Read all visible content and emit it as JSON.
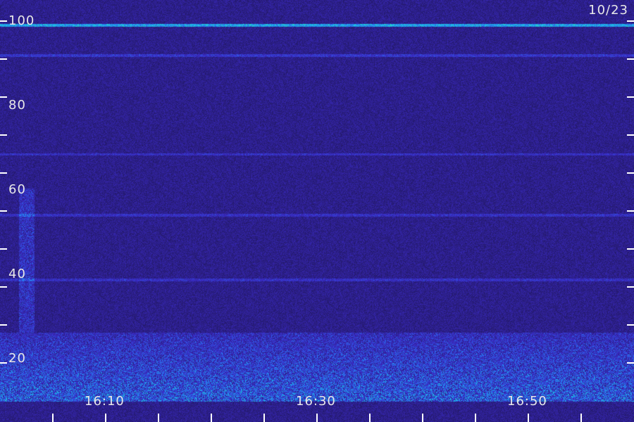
{
  "chart_data": {
    "type": "heatmap",
    "title": "",
    "xlabel": "",
    "ylabel": "",
    "date_label": "10/23",
    "x_tick_labels": [
      "16:10",
      "16:30",
      "16:50"
    ],
    "y_tick_labels": [
      "20",
      "40",
      "60",
      "80",
      "100"
    ],
    "ylim": [
      0,
      100
    ],
    "y_tick_values": [
      20,
      40,
      60,
      80,
      100
    ],
    "x_range_minutes": [
      "16:00",
      "17:00"
    ],
    "x_tick_positions_minutes": [
      10,
      30,
      50
    ],
    "colormap": [
      "#1a1450",
      "#2d1f8a",
      "#3a2cc8",
      "#2a6ef0",
      "#19c9e6",
      "#38f08a"
    ],
    "features": [
      {
        "kind": "horizontal_line",
        "y": 99,
        "intensity": 0.85
      },
      {
        "kind": "horizontal_line",
        "y": 91,
        "intensity": 0.35
      },
      {
        "kind": "horizontal_line",
        "y": 65,
        "intensity": 0.3
      },
      {
        "kind": "horizontal_line",
        "y": 49,
        "intensity": 0.3
      },
      {
        "kind": "horizontal_line",
        "y": 32,
        "intensity": 0.3
      },
      {
        "kind": "band",
        "y_from": 0,
        "y_to": 18,
        "intensity": 0.8
      },
      {
        "kind": "vertical_burst",
        "x_from": 1.8,
        "x_to": 3.2,
        "y_from": 18,
        "y_to": 56,
        "intensity": 0.45
      }
    ]
  }
}
